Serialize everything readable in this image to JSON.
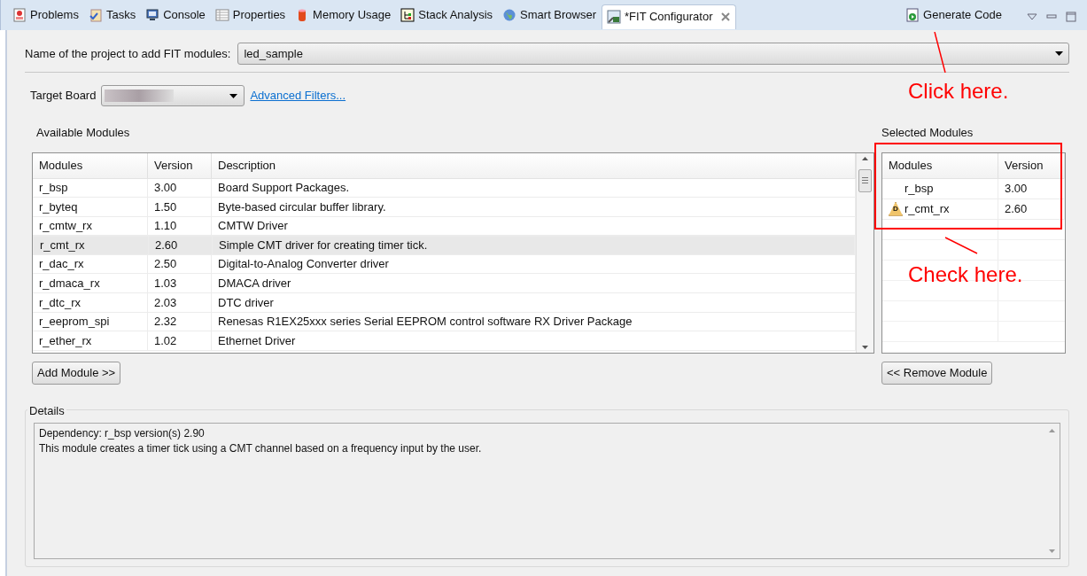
{
  "tabs": [
    {
      "label": "Problems",
      "selected": false
    },
    {
      "label": "Tasks",
      "selected": false
    },
    {
      "label": "Console",
      "selected": false
    },
    {
      "label": "Properties",
      "selected": false
    },
    {
      "label": "Memory Usage",
      "selected": false
    },
    {
      "label": "Stack Analysis",
      "selected": false
    },
    {
      "label": "Smart Browser",
      "selected": false
    },
    {
      "label": "*FIT Configurator",
      "selected": true
    }
  ],
  "toolbar": {
    "generate_code": "Generate Code"
  },
  "project": {
    "label": "Name of the project to add FIT modules:",
    "value": "led_sample"
  },
  "target_board": {
    "label": "Target Board",
    "advanced_filters": "Advanced Filters..."
  },
  "available": {
    "title": "Available Modules",
    "columns": [
      "Modules",
      "Version",
      "Description"
    ],
    "rows": [
      {
        "cells": [
          "r_bsp",
          "3.00",
          "Board Support Packages."
        ],
        "selected": false
      },
      {
        "cells": [
          "r_byteq",
          "1.50",
          "Byte-based circular buffer library."
        ],
        "selected": false
      },
      {
        "cells": [
          "r_cmtw_rx",
          "1.10",
          "CMTW Driver"
        ],
        "selected": false
      },
      {
        "cells": [
          "r_cmt_rx",
          "2.60",
          "Simple CMT driver for creating timer tick."
        ],
        "selected": true
      },
      {
        "cells": [
          "r_dac_rx",
          "2.50",
          "Digital-to-Analog Converter driver"
        ],
        "selected": false
      },
      {
        "cells": [
          "r_dmaca_rx",
          "1.03",
          "DMACA driver"
        ],
        "selected": false
      },
      {
        "cells": [
          "r_dtc_rx",
          "2.03",
          "DTC driver"
        ],
        "selected": false
      },
      {
        "cells": [
          "r_eeprom_spi",
          "2.32",
          "Renesas R1EX25xxx series Serial EEPROM control software RX Driver Package"
        ],
        "selected": false
      },
      {
        "cells": [
          "r_ether_rx",
          "1.02",
          "Ethernet Driver"
        ],
        "selected": false
      }
    ],
    "add_button": "Add Module >>"
  },
  "selected_modules": {
    "title": "Selected Modules",
    "columns": [
      "Modules",
      "Version"
    ],
    "rows": [
      {
        "cells": [
          "r_bsp",
          "3.00"
        ]
      },
      {
        "cells": [
          "r_cmt_rx",
          "2.60"
        ],
        "badge": "D"
      }
    ],
    "remove_button": "<< Remove Module"
  },
  "details": {
    "title": "Details",
    "lines": [
      "Dependency: r_bsp version(s) 2.90",
      "This module creates a timer tick using a CMT channel based on a frequency input by the user."
    ]
  },
  "annotations": [
    {
      "text": "Click here."
    },
    {
      "text": "Check here."
    }
  ]
}
